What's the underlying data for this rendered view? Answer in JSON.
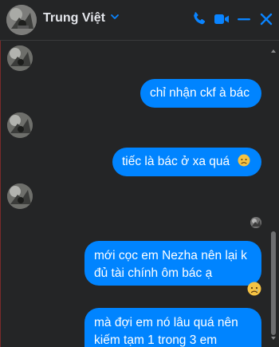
{
  "header": {
    "contact_name": "Trung Việt",
    "icons": [
      "phone-icon",
      "video-call-icon",
      "minimize-icon",
      "close-icon"
    ]
  },
  "messages": [
    {
      "from": "me",
      "text": "chỉ nhận ckf à bác"
    },
    {
      "from": "me",
      "text": "tiếc là bác ở xa quá",
      "emoji": "disappointed-face"
    },
    {
      "from": "me",
      "text": "mới cọc em Nezha nên lại k đủ tài chính ôm bác ạ",
      "reaction": "sad-face"
    },
    {
      "from": "me",
      "text": "mà đợi em nó lâu quá nên kiếm tạm 1 trong 3 em"
    }
  ],
  "colors": {
    "background": "#242526",
    "bubble": "#0084ff",
    "accent": "#0a84ff",
    "text": "#e4e6eb"
  }
}
